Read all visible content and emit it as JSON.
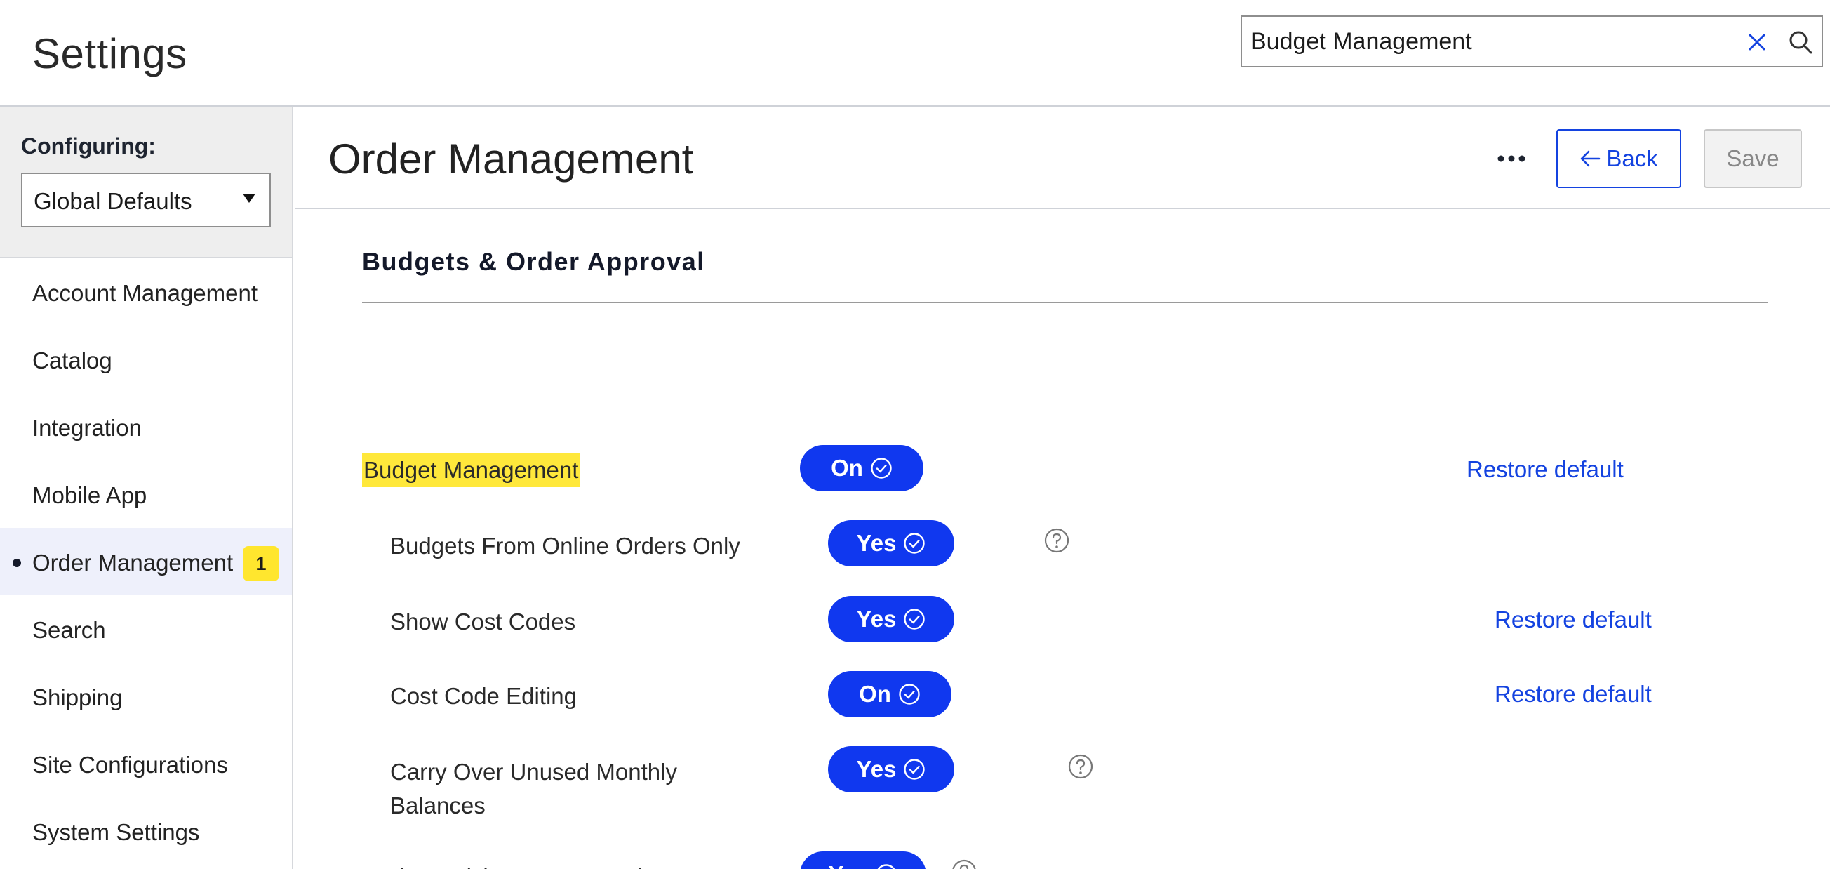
{
  "app": {
    "title": "Settings"
  },
  "search": {
    "value": "Budget Management",
    "placeholder": ""
  },
  "sidebar": {
    "configuring_label": "Configuring:",
    "configuring_value": "Global Defaults",
    "items": [
      {
        "label": "Account Management"
      },
      {
        "label": "Catalog"
      },
      {
        "label": "Integration"
      },
      {
        "label": "Mobile App"
      },
      {
        "label": "Order Management",
        "badge": "1",
        "active": true
      },
      {
        "label": "Search"
      },
      {
        "label": "Shipping"
      },
      {
        "label": "Site Configurations"
      },
      {
        "label": "System Settings"
      }
    ]
  },
  "main": {
    "page_title": "Order Management",
    "back_label": "Back",
    "save_label": "Save",
    "section_title": "Budgets & Order Approval",
    "settings": [
      {
        "label": "Budget Management",
        "toggle": "On",
        "restore": "Restore default"
      },
      {
        "label": "Budgets From Online Orders Only",
        "toggle": "Yes"
      },
      {
        "label": "Show Cost Codes",
        "toggle": "Yes",
        "restore": "Restore default"
      },
      {
        "label": "Cost Code Editing",
        "toggle": "On",
        "restore": "Restore default"
      },
      {
        "label_line1": "Carry Over Unused Monthly",
        "label_line2": "Balances",
        "toggle": "Yes"
      },
      {
        "label": "Update Pricing on Approval",
        "toggle": "Yes"
      }
    ]
  },
  "colors": {
    "accent": "#1038ef",
    "link": "#1443e0",
    "highlight": "#ffe83b",
    "badge": "#ffe62e"
  }
}
